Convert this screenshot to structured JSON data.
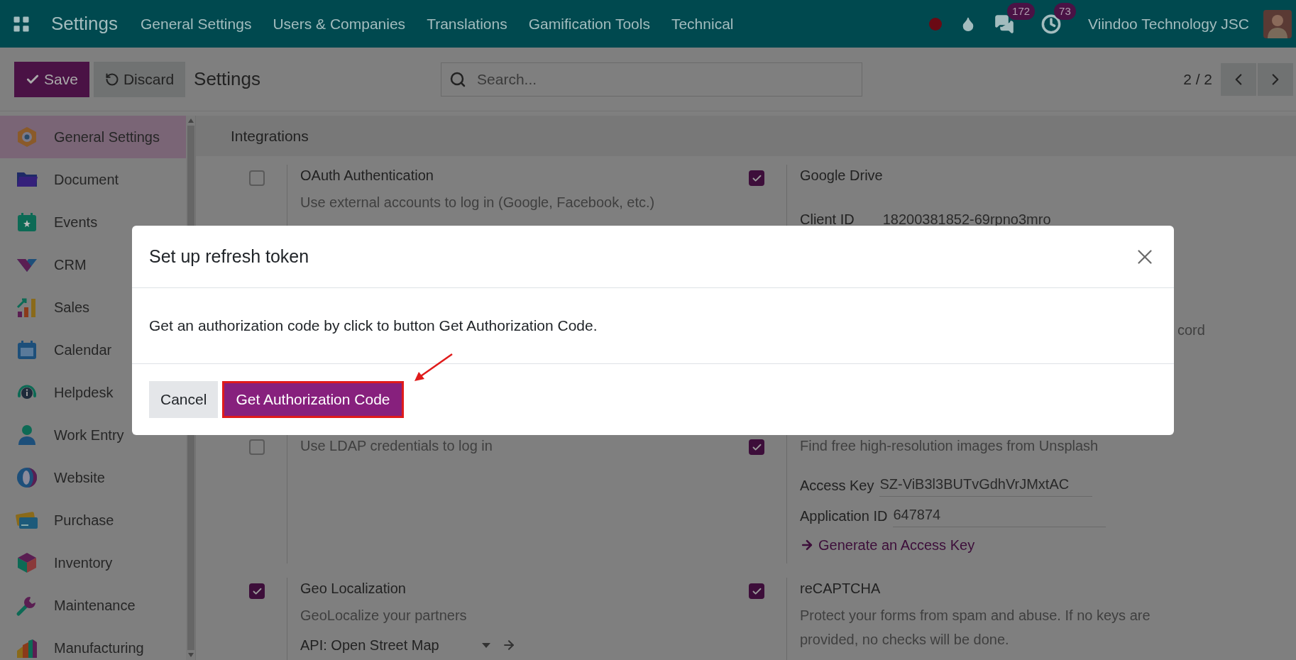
{
  "navbar": {
    "app_title": "Settings",
    "menu": [
      "General Settings",
      "Users & Companies",
      "Translations",
      "Gamification Tools",
      "Technical"
    ],
    "systray": [
      {
        "kind": "dot"
      },
      {
        "kind": "drop"
      },
      {
        "kind": "chat",
        "badge": "172"
      },
      {
        "kind": "clock",
        "badge": "73"
      }
    ],
    "company": "Viindoo Technology JSC"
  },
  "control_panel": {
    "buttons": [
      {
        "kind": "primary",
        "label": "Save"
      },
      {
        "kind": "secondary",
        "label": "Discard"
      }
    ],
    "breadcrumb": "Settings",
    "search": {
      "placeholder": "Search..."
    },
    "pager": "2 / 2"
  },
  "sidebar": {
    "items": [
      {
        "label": "General Settings",
        "selected": true
      },
      {
        "label": "Document",
        "selected": false
      },
      {
        "label": "Events",
        "selected": false
      },
      {
        "label": "CRM",
        "selected": false
      },
      {
        "label": "Sales",
        "selected": false
      },
      {
        "label": "Calendar",
        "selected": false
      },
      {
        "label": "Helpdesk",
        "selected": false
      },
      {
        "label": "Work Entry",
        "selected": false
      },
      {
        "label": "Website",
        "selected": false
      },
      {
        "label": "Purchase",
        "selected": false
      },
      {
        "label": "Inventory",
        "selected": false
      },
      {
        "label": "Maintenance",
        "selected": false
      },
      {
        "label": "Manufacturing",
        "selected": false
      }
    ]
  },
  "section": {
    "title": "Integrations",
    "rows": [
      [
        {
          "title": "OAuth Authentication",
          "checked": false,
          "description": "Use external accounts to log in (Google, Facebook, etc.)"
        },
        {
          "title": "Google Drive",
          "checked": true,
          "fields": [
            {
              "label": "Client ID",
              "value": "18200381852-69rpno3mro"
            }
          ],
          "tail": "cord"
        }
      ],
      [
        {
          "checked": false,
          "description": "Use LDAP credentials to log in"
        },
        {
          "checked": true,
          "description": "Find free high-resolution images from Unsplash",
          "fields": [
            {
              "label": "Access Key",
              "value": "SZ-ViB3l3BUTvGdhVrJMxtAC"
            },
            {
              "label": "Application ID",
              "value": "647874"
            }
          ],
          "link": "Generate an Access Key"
        }
      ],
      [
        {
          "title": "Geo Localization",
          "checked": true,
          "description": "GeoLocalize your partners",
          "select": "API: Open Street Map"
        },
        {
          "title": "reCAPTCHA",
          "checked": true,
          "description": "Protect your forms from spam and abuse. If no keys are provided, no checks will be done."
        }
      ]
    ]
  },
  "dialog": {
    "title": "Set up refresh token",
    "message": "Get an authorization code by click to button Get Authorization Code.",
    "buttons": [
      {
        "kind": "secondary",
        "label": "Cancel"
      },
      {
        "kind": "primary",
        "label": "Get Authorization Code",
        "highlighted": true
      }
    ]
  }
}
